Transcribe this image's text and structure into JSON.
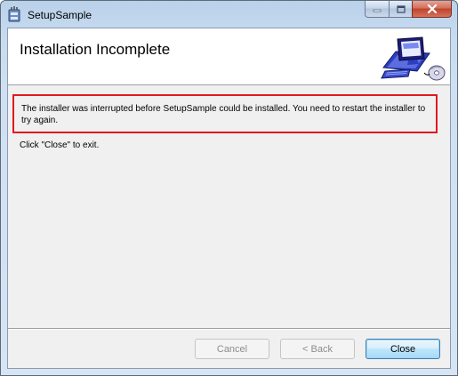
{
  "window": {
    "title": "SetupSample",
    "controls": {
      "minimize_icon": "minimize-icon",
      "maximize_icon": "maximize-icon",
      "close_icon": "close-icon"
    }
  },
  "banner": {
    "title": "Installation Incomplete",
    "art": "computer-with-disc-icon"
  },
  "body": {
    "message": "The installer was interrupted before SetupSample could be installed. You need to restart the installer to try again.",
    "hint": "Click \"Close\" to exit."
  },
  "buttons": {
    "cancel": "Cancel",
    "back": "< Back",
    "close": "Close"
  },
  "colors": {
    "highlight_border": "#e0191f",
    "default_button_border": "#3c7fb1"
  }
}
